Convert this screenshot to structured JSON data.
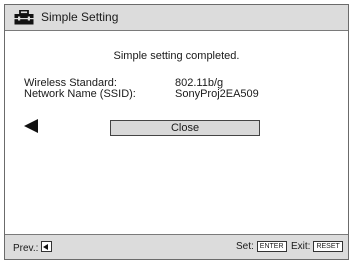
{
  "window": {
    "title": "Simple Setting"
  },
  "message": "Simple setting completed.",
  "info": [
    {
      "label": "Wireless Standard:",
      "value": "802.11b/g"
    },
    {
      "label": "Network Name (SSID):",
      "value": "SonyProj2EA509"
    }
  ],
  "actions": {
    "close_label": "Close"
  },
  "footer": {
    "prev_label": "Prev.:",
    "set_label": "Set:",
    "set_key": "ENTER",
    "exit_label": "Exit:",
    "exit_key": "RESET"
  },
  "icons": {
    "title": "toolbox-icon",
    "back": "left-arrow-icon",
    "prev_key": "left-arrow-key-icon"
  },
  "colors": {
    "titlebar_bg": "#dcdcdc",
    "button_bg": "#d9d9d9",
    "border": "#6b6b6b"
  }
}
